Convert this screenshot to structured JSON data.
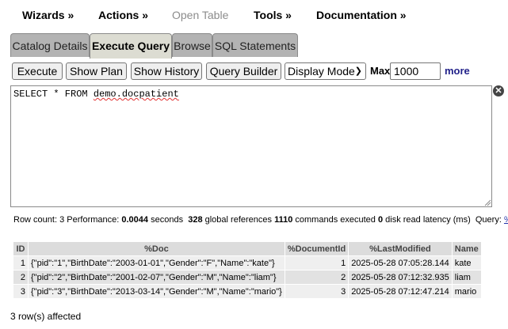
{
  "menu": {
    "wizards": "Wizards »",
    "actions": "Actions »",
    "open_table": "Open Table",
    "tools": "Tools »",
    "documentation": "Documentation »"
  },
  "tabs": [
    {
      "label": "Catalog Details",
      "active": false
    },
    {
      "label": "Execute Query",
      "active": true
    },
    {
      "label": "Browse",
      "active": false
    },
    {
      "label": "SQL Statements",
      "active": false
    }
  ],
  "toolbar": {
    "execute": "Execute",
    "show_plan": "Show Plan",
    "show_history": "Show History",
    "query_builder": "Query Builder",
    "display_mode": "Display Mode",
    "max_label": "Max",
    "max_value": "1000",
    "more": "more"
  },
  "editor": {
    "query_prefix": "SELECT * FROM ",
    "query_table": "demo.docpatient"
  },
  "status": {
    "row_count_label": "Row count:",
    "row_count": "3",
    "performance_label": "Performance:",
    "seconds": "0.0044",
    "seconds_label": "seconds",
    "global_refs": "328",
    "global_refs_label": "global references",
    "commands": "1110",
    "commands_label": "commands executed",
    "disk_latency": "0",
    "disk_latency_label": "disk read latency (ms)",
    "query_label": "Query:",
    "query_link": "%s"
  },
  "table": {
    "columns": [
      "ID",
      "%Doc",
      "%DocumentId",
      "%LastModified",
      "Name"
    ],
    "rows": [
      [
        "1",
        "{\"pid\":\"1\",\"BirthDate\":\"2003-01-01\",\"Gender\":\"F\",\"Name\":\"kate\"}",
        "1",
        "2025-05-28 07:05:28.144",
        "kate"
      ],
      [
        "2",
        "{\"pid\":\"2\",\"BirthDate\":\"2001-02-07\",\"Gender\":\"M\",\"Name\":\"liam\"}",
        "2",
        "2025-05-28 07:12:32.935",
        "liam"
      ],
      [
        "3",
        "{\"pid\":\"3\",\"BirthDate\":\"2013-03-14\",\"Gender\":\"M\",\"Name\":\"mario\"}",
        "3",
        "2025-05-28 07:12:47.214",
        "mario"
      ]
    ]
  },
  "affected": "3 row(s) affected",
  "colors": {
    "tab_active": "#dcdcd2",
    "tab_inactive": "#b3b3b3",
    "link": "#22228a"
  },
  "icons": {
    "clear": "clear-x-icon",
    "select_chevron": "chevron-down-icon"
  }
}
